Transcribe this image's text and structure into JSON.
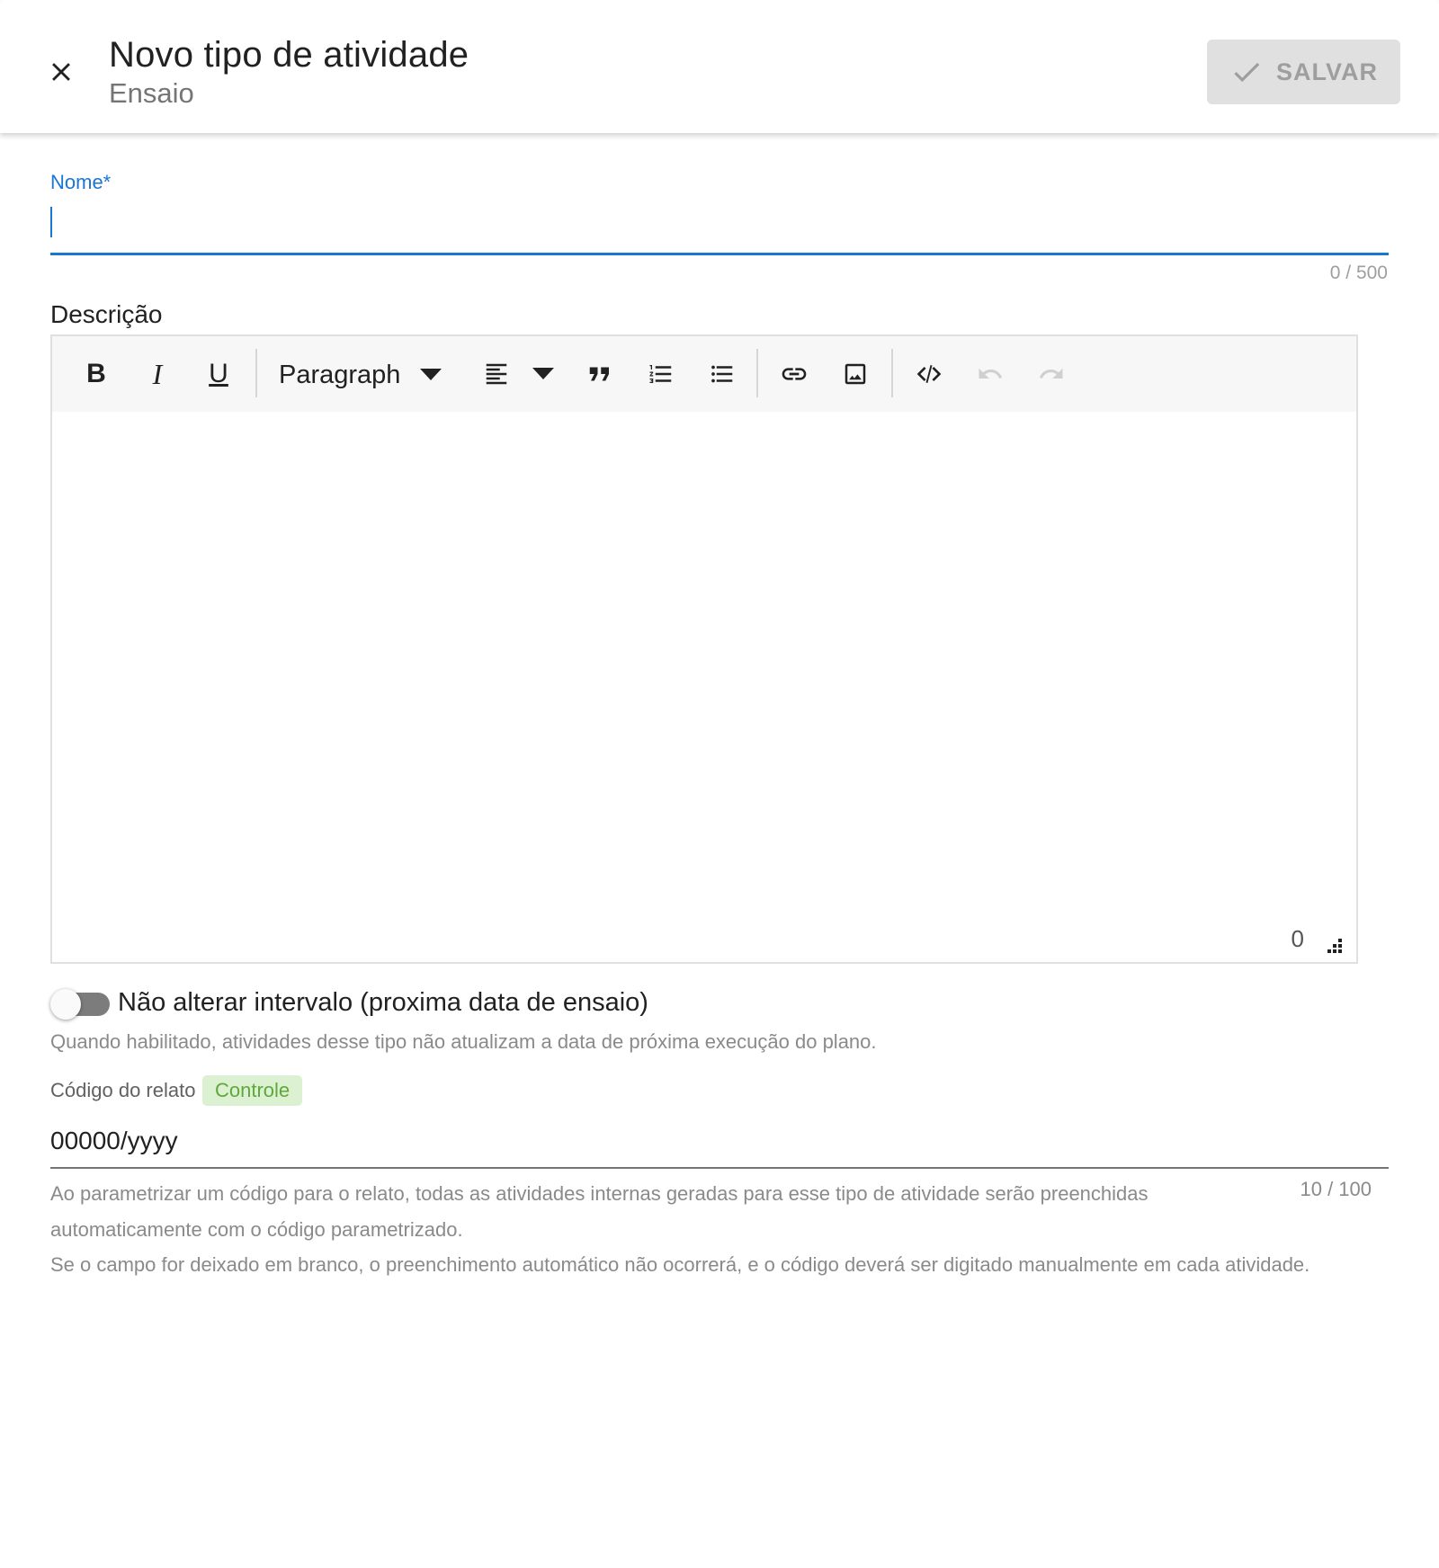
{
  "header": {
    "title": "Novo tipo de atividade",
    "subtitle": "Ensaio",
    "save_label": "SALVAR",
    "close_icon": "close-icon",
    "save_icon": "check-icon"
  },
  "nome": {
    "label": "Nome*",
    "value": "",
    "counter": "0 / 500"
  },
  "descricao": {
    "label": "Descrição",
    "toolbar": {
      "bold": "B",
      "italic": "I",
      "underline": "U",
      "block_format": "Paragraph"
    },
    "char_count": "0"
  },
  "toggle": {
    "label": "Não alterar intervalo (proxima data de ensaio)",
    "hint": "Quando habilitado, atividades desse tipo não atualizam a data de próxima execução do plano.",
    "checked": false
  },
  "codigo": {
    "label": "Código do relato",
    "badge": "Controle",
    "value": "00000/yyyy",
    "counter": "10 / 100",
    "hint1": "Ao parametrizar um código para o relato, todas as atividades internas geradas para esse tipo de atividade serão preenchidas automaticamente com o código parametrizado.",
    "hint2": "Se o campo for deixado em branco, o preenchimento automático não ocorrerá, e o código deverá ser digitado manualmente em cada atividade."
  },
  "colors": {
    "accent": "#1976d2",
    "badge_bg": "#dcf0d2",
    "badge_text": "#5fa83b",
    "disabled_button": "#e0e0e0"
  }
}
